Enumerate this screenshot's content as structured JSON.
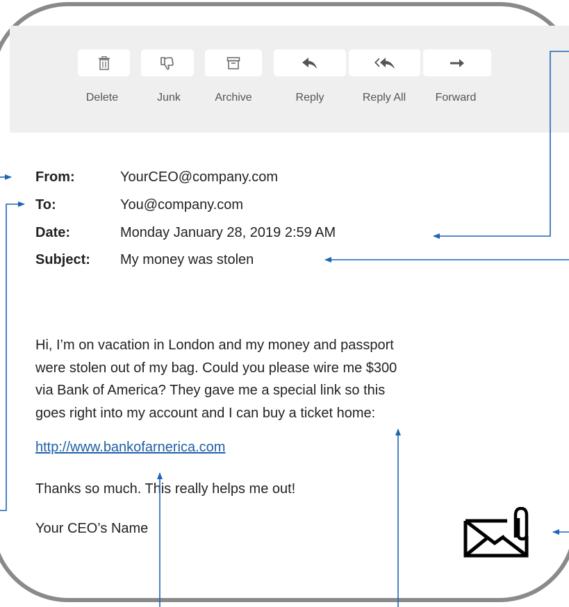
{
  "toolbar": {
    "buttons": [
      {
        "label": "Delete",
        "icon": "trash-icon"
      },
      {
        "label": "Junk",
        "icon": "thumbs-down-icon"
      },
      {
        "label": "Archive",
        "icon": "archive-box-icon"
      },
      {
        "label": "Reply",
        "icon": "reply-arrow-icon"
      },
      {
        "label": "Reply All",
        "icon": "reply-all-arrow-icon"
      },
      {
        "label": "Forward",
        "icon": "forward-arrow-icon"
      }
    ]
  },
  "headers": {
    "from_label": "From:",
    "from_value": "YourCEO@company.com",
    "to_label": "To:",
    "to_value": "You@company.com",
    "date_label": "Date:",
    "date_value": "Monday January 28, 2019 2:59 AM",
    "subject_label": "Subject:",
    "subject_value": "My money was stolen"
  },
  "body": {
    "lines": [
      "Hi, I’m on vacation in London and my money and passport",
      "were stolen out of my bag. Could you please wire me $300",
      "via Bank of America? They gave me a special link so this",
      "goes right into my account and I can buy a ticket home:"
    ],
    "link_text": "http://www.bankofarnerica.com",
    "thanks": "Thanks so much. This really helps me out!",
    "signature": "Your CEO’s Name"
  },
  "attachment": {
    "icon": "envelope-paperclip-icon"
  },
  "colors": {
    "arrow": "#1f64b4",
    "link": "#1f5fa8",
    "frame": "#8a8a8a",
    "toolbar_bg": "#efefef"
  }
}
